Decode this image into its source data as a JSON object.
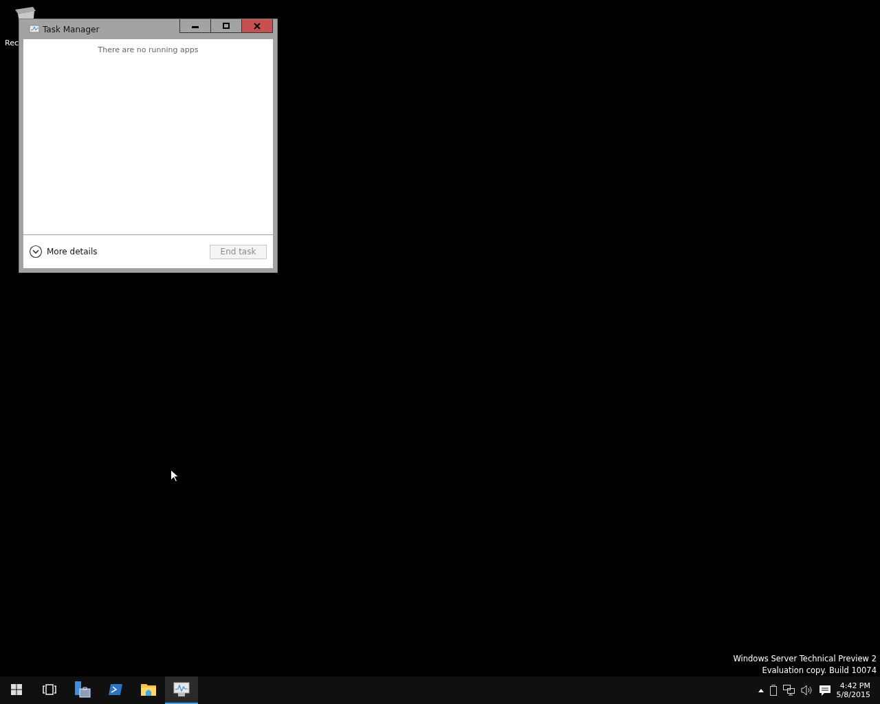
{
  "desktop": {
    "icons": [
      {
        "label": "Rec"
      }
    ],
    "watermark_text": [
      "Windows Server Technical Preview 2",
      "Evaluation copy. Build 10074"
    ]
  },
  "window": {
    "title": "Task Manager",
    "empty_message": "There are no running apps",
    "more_details": {
      "label": "More details",
      "expanded": false
    },
    "end_task": {
      "label": "End task",
      "disabled": true
    }
  },
  "taskbar": {
    "items": [
      {
        "kind": "start",
        "selected": false
      },
      {
        "kind": "taskview",
        "selected": false
      },
      {
        "kind": "server",
        "selected": false
      },
      {
        "kind": "shell",
        "selected": false
      },
      {
        "kind": "folder",
        "selected": false
      },
      {
        "kind": "monitor",
        "selected": true
      }
    ],
    "clock": {
      "time": "4:42 PM",
      "date": "5/8/2015"
    }
  }
}
